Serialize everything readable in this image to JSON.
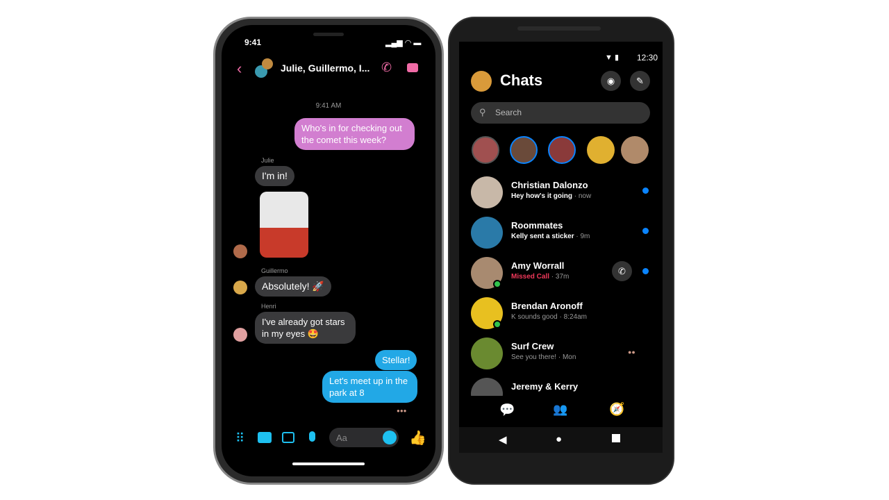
{
  "left_phone": {
    "status_time": "9:41",
    "header": {
      "title": "Julie, Guillermo, I...",
      "back_icon": "chevron-left-icon",
      "call_icon": "phone-icon",
      "video_icon": "video-camera-icon",
      "accent": "#f06ba6"
    },
    "timestamp": "9:41 AM",
    "messages": [
      {
        "sender": "",
        "text": "Who's in for checking out the comet this week?",
        "outgoing": true,
        "color": "#d27ed0"
      },
      {
        "sender": "Julie",
        "text": "I'm in!",
        "outgoing": false
      },
      {
        "sender": "",
        "text": "",
        "sticker": "pug-3d-glasses-popcorn-sticker",
        "outgoing": false
      },
      {
        "sender": "Guillermo",
        "text": "Absolutely! 🚀",
        "outgoing": false
      },
      {
        "sender": "Henri",
        "text": "I've already got stars in my eyes 🤩",
        "outgoing": false
      },
      {
        "sender": "",
        "text": "Stellar!",
        "outgoing": true,
        "color": "#22a8e6"
      },
      {
        "sender": "",
        "text": "Let's meet up in the park at 8",
        "outgoing": true,
        "color": "#22a8e6"
      }
    ],
    "composer": {
      "placeholder": "Aa",
      "icons": [
        "grid-icon",
        "camera-icon",
        "image-icon",
        "microphone-icon",
        "emoji-icon",
        "thumbs-up-icon"
      ],
      "accent": "#1ec0f0"
    }
  },
  "right_phone": {
    "status_time": "12:30",
    "title": "Chats",
    "search_placeholder": "Search",
    "chats": [
      {
        "name": "Christian Dalonzo",
        "preview": "Hey how's it going",
        "time": "now",
        "unread": true,
        "bold": true
      },
      {
        "name": "Roommates",
        "preview": "Kelly sent a sticker",
        "time": "9m",
        "unread": true,
        "bold": true
      },
      {
        "name": "Amy Worrall",
        "preview": "Missed Call",
        "time": "37m",
        "unread": true,
        "missed": true,
        "online": true,
        "call_button": true
      },
      {
        "name": "Brendan Aronoff",
        "preview": "K sounds good",
        "time": "8:24am",
        "online": true
      },
      {
        "name": "Surf Crew",
        "preview": "See you there!",
        "time": "Mon"
      },
      {
        "name": "Jeremy & Kerry",
        "preview": "",
        "time": ""
      }
    ],
    "bottom_nav": [
      "chats-icon",
      "people-icon",
      "discover-icon"
    ],
    "system_nav": [
      "back-icon",
      "home-icon",
      "recents-icon"
    ],
    "unread_color": "#0a84ff",
    "missed_color": "#f0385a"
  }
}
